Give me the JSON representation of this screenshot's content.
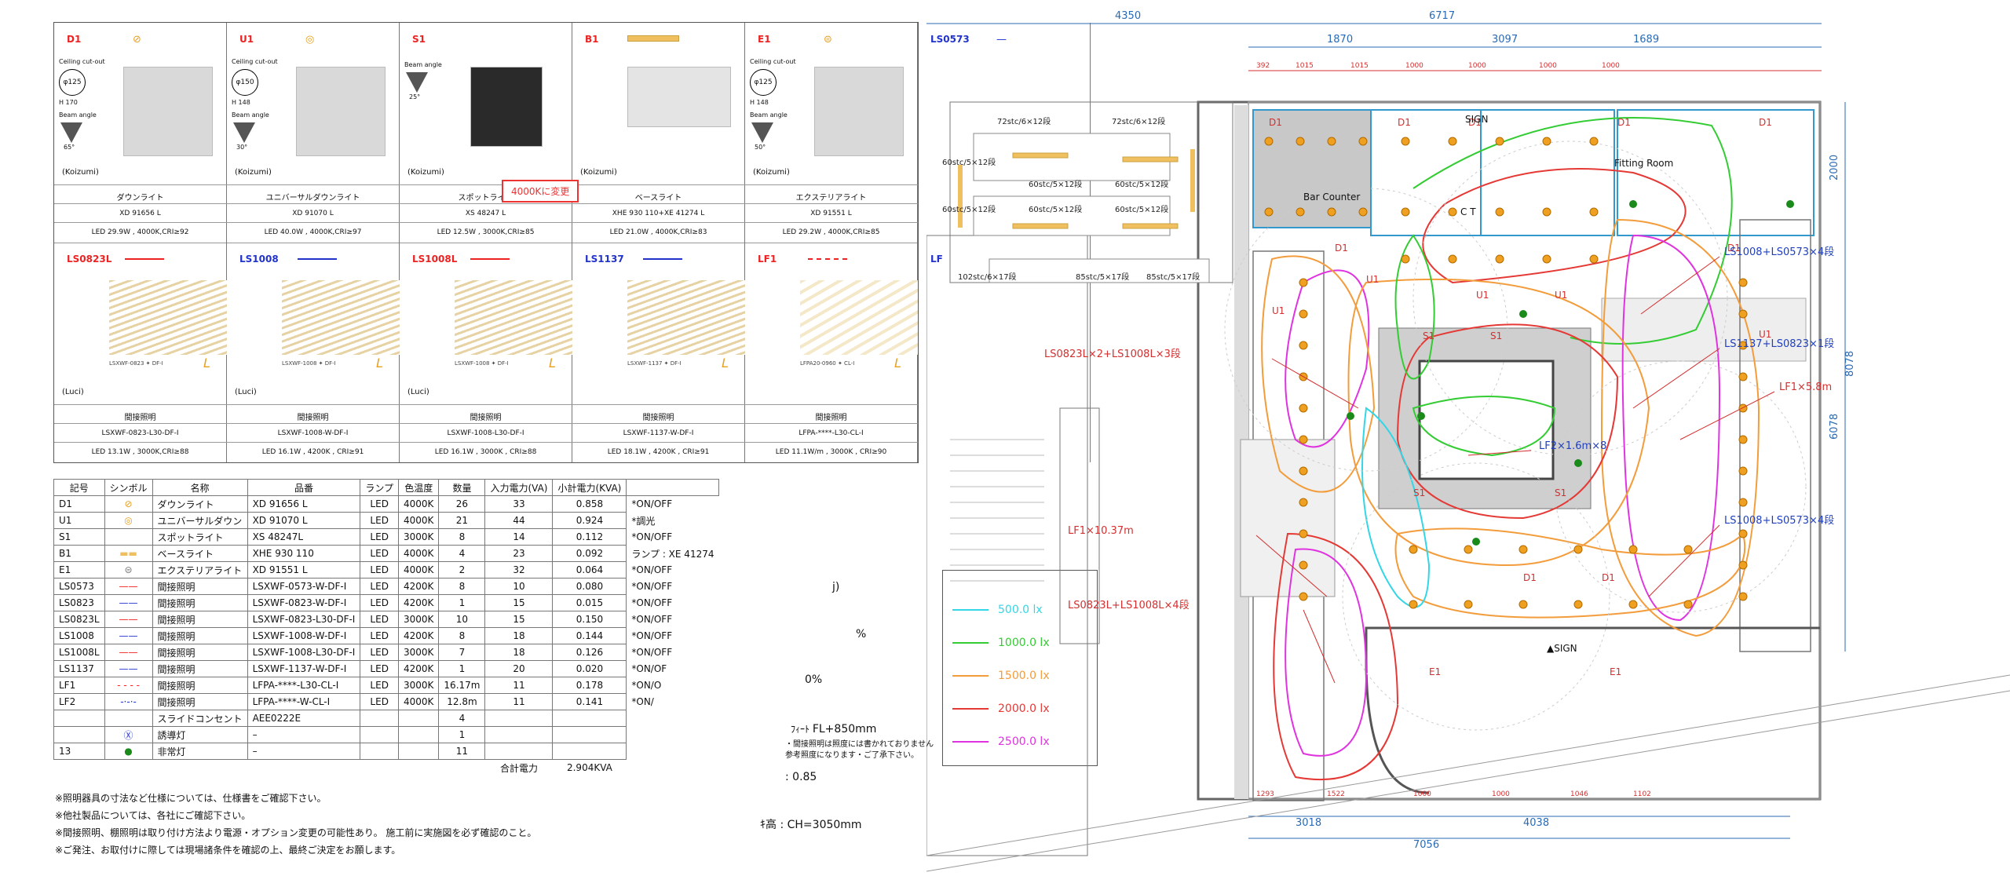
{
  "catalog": {
    "row1": [
      {
        "code": "D1",
        "symbol": "⊘",
        "cutout": "Ceiling cut-out",
        "cutout_dim": "φ125",
        "h": "H 170",
        "beam_label": "Beam angle",
        "beam": "65°",
        "maker": "(Koizumi)",
        "name": "ダウンライト",
        "model": "XD 91656 L",
        "spec": "LED 29.9W , 4000K,CRI≥92"
      },
      {
        "code": "U1",
        "symbol": "◎",
        "cutout": "Ceiling cut-out",
        "cutout_dim": "φ150",
        "h": "H 148",
        "beam_label": "Beam angle",
        "beam": "30°",
        "maker": "(Koizumi)",
        "name": "ユニバーサルダウンライト",
        "model": "XD 91070 L",
        "spec": "LED 40.0W , 4000K,CRI≥97"
      },
      {
        "code": "S1",
        "symbol": "",
        "cutout": "",
        "cutout_dim": "",
        "h": "",
        "beam_label": "Beam angle",
        "beam": "25°",
        "maker": "(Koizumi)",
        "name": "スポットライト",
        "model": "XS 48247 L",
        "spec": "LED 12.5W , 3000K,CRI≥85"
      },
      {
        "code": "B1",
        "symbol": "▬",
        "cutout": "",
        "cutout_dim": "",
        "h": "",
        "beam_label": "",
        "beam": "",
        "maker": "(Koizumi)",
        "name": "ベースライト",
        "model": "XHE 930 110+XE 41274 L",
        "spec": "LED 21.0W , 4000K,CRI≥83"
      },
      {
        "code": "E1",
        "symbol": "⊜",
        "cutout": "Ceiling cut-out",
        "cutout_dim": "φ125",
        "h": "H 148",
        "beam_label": "Beam angle",
        "beam": "50°",
        "maker": "(Koizumi)",
        "name": "エクステリアライト",
        "model": "XD 91551 L",
        "spec": "LED 29.2W , 4000K,CRI≥85"
      },
      {
        "code": "LS0573",
        "symbol": "—",
        "cutout": "",
        "cutout_dim": "",
        "h": "",
        "beam_label": "",
        "beam": "",
        "maker": "(Luci)",
        "name": "",
        "model": "",
        "spec": ""
      }
    ],
    "row2": [
      {
        "code": "LS0823L",
        "maker": "(Luci)",
        "name": "間接照明",
        "model": "LSXWF-0823-L30-DF-I",
        "spec": "LED 13.1W , 3000K,CRI≥88",
        "label": "LSXWF-0823 ✦ DF-I"
      },
      {
        "code": "LS1008",
        "maker": "(Luci)",
        "name": "間接照明",
        "model": "LSXWF-1008-W-DF-I",
        "spec": "LED 16.1W , 4200K , CRI≥91",
        "label": "LSXWF-1008 ✦ DF-I"
      },
      {
        "code": "LS1008L",
        "maker": "(Luci)",
        "name": "間接照明",
        "model": "LSXWF-1008-L30-DF-I",
        "spec": "LED 16.1W , 3000K , CRI≥88",
        "label": "LSXWF-1008 ✦ DF-I"
      },
      {
        "code": "LS1137",
        "maker": "",
        "name": "間接照明",
        "model": "LSXWF-1137-W-DF-I",
        "spec": "LED 18.1W , 4200K , CRI≥91",
        "label": "LSXWF-1137 ✦ DF-I"
      },
      {
        "code": "LF1",
        "maker": "",
        "name": "間接照明",
        "model": "LFPA-****-L30-CL-I",
        "spec": "LED 11.1W/m , 3000K , CRI≥90",
        "label": "LFPA20-0960 ✦ CL-I"
      },
      {
        "code": "LF",
        "maker": "",
        "name": "",
        "model": "",
        "spec": "",
        "label": ""
      }
    ],
    "change_note": "4000Kに変更"
  },
  "schedule": {
    "headers": [
      "記号",
      "シンボル",
      "名称",
      "品番",
      "ランプ",
      "色温度",
      "数量",
      "入力電力(VA)",
      "小計電力(KVA)",
      ""
    ],
    "rows": [
      [
        "D1",
        "⊘",
        "ダウンライト",
        "XD 91656 L",
        "LED",
        "4000K",
        "26",
        "33",
        "0.858",
        "*ON/OFF"
      ],
      [
        "U1",
        "◎",
        "ユニバーサルダウン",
        "XD 91070 L",
        "LED",
        "4000K",
        "21",
        "44",
        "0.924",
        "*調光"
      ],
      [
        "S1",
        "",
        "スポットライト",
        "XS 48247L",
        "LED",
        "3000K",
        "8",
        "14",
        "0.112",
        "*ON/OFF"
      ],
      [
        "B1",
        "▬▬",
        "ベースライト",
        "XHE 930 110",
        "LED",
        "4000K",
        "4",
        "23",
        "0.092",
        "ランプ : XE 41274"
      ],
      [
        "E1",
        "⊜",
        "エクステリアライト",
        "XD 91551 L",
        "LED",
        "4000K",
        "2",
        "32",
        "0.064",
        "*ON/OFF"
      ],
      [
        "LS0573",
        "——",
        "間接照明",
        "LSXWF-0573-W-DF-I",
        "LED",
        "4200K",
        "8",
        "10",
        "0.080",
        "*ON/OFF"
      ],
      [
        "LS0823",
        "——",
        "間接照明",
        "LSXWF-0823-W-DF-I",
        "LED",
        "4200K",
        "1",
        "15",
        "0.015",
        "*ON/OFF"
      ],
      [
        "LS0823L",
        "——",
        "間接照明",
        "LSXWF-0823-L30-DF-I",
        "LED",
        "3000K",
        "10",
        "15",
        "0.150",
        "*ON/OFF"
      ],
      [
        "LS1008",
        "——",
        "間接照明",
        "LSXWF-1008-W-DF-I",
        "LED",
        "4200K",
        "8",
        "18",
        "0.144",
        "*ON/OFF"
      ],
      [
        "LS1008L",
        "——",
        "間接照明",
        "LSXWF-1008-L30-DF-I",
        "LED",
        "3000K",
        "7",
        "18",
        "0.126",
        "*ON/OFF"
      ],
      [
        "LS1137",
        "——",
        "間接照明",
        "LSXWF-1137-W-DF-I",
        "LED",
        "4200K",
        "1",
        "20",
        "0.020",
        "*ON/OF"
      ],
      [
        "LF1",
        "- - - -",
        "間接照明",
        "LFPA-****-L30-CL-I",
        "LED",
        "3000K",
        "16.17m",
        "11",
        "0.178",
        "*ON/O"
      ],
      [
        "LF2",
        "-·-·-",
        "間接照明",
        "LFPA-****-W-CL-I",
        "LED",
        "4000K",
        "12.8m",
        "11",
        "0.141",
        "*ON/"
      ],
      [
        "",
        "",
        "スライドコンセント",
        "AEE0222E",
        "",
        "",
        "4",
        "",
        "",
        ""
      ],
      [
        "",
        "Ⓧ",
        "誘導灯",
        "–",
        "",
        "",
        "1",
        "",
        "",
        ""
      ],
      [
        "13",
        "●",
        "非常灯",
        "–",
        "",
        "",
        "11",
        "",
        "",
        ""
      ]
    ],
    "total_label": "合計電力",
    "total_value": "2.904KVA"
  },
  "notes": [
    "※照明器具の寸法など仕様については、仕様書をご確認下さい。",
    "※他社製品については、各社にご確認下さい。",
    "※間接照明、棚照明は取り付け方法より電源・オプション変更の可能性あり。 施工前に実施図を必ず確認のこと。",
    "※ご発注、お取付けに際しては現場諸条件を確認の上、最終ご決定をお願します。"
  ],
  "side_texts": {
    "fl": "FL+850mm",
    "indirect_note": "・間接照明は照度には書かれておりません",
    "ref_note": "参考照度になります・ご了承下さい。",
    "ratio": "0.85",
    "ceiling": "CH=3050mm",
    "j": "j)",
    "pct1": "%",
    "pct2": "0%"
  },
  "legend": [
    {
      "label": "500.0 lx",
      "color": "#33d6e6"
    },
    {
      "label": "1000.0 lx",
      "color": "#33cc33"
    },
    {
      "label": "1500.0 lx",
      "color": "#f39c3b"
    },
    {
      "label": "2000.0 lx",
      "color": "#e53935"
    },
    {
      "label": "2500.0 lx",
      "color": "#e033e0"
    }
  ],
  "plan": {
    "dims_top": [
      "4350",
      "6717",
      "1870",
      "3097",
      "1689"
    ],
    "dims_sub": [
      "392",
      "1015",
      "1015",
      "1000",
      "1000",
      "1000",
      "1000"
    ],
    "dims_right": [
      "2000",
      "8078",
      "6078"
    ],
    "dims_bottom": [
      "3018",
      "4038",
      "7056"
    ],
    "dims_bottom_sub": [
      "1293",
      "1522",
      "1000",
      "1000",
      "1046",
      "1102"
    ],
    "rooms": [
      "Bar Counter",
      "Fitting Room",
      "SIGN",
      "▲SIGN",
      "C T"
    ],
    "callouts": [
      {
        "text": "LS1008+LS0573×4段"
      },
      {
        "text": "LS1137+LS0823×1段"
      },
      {
        "text": "LF1×5.8m"
      },
      {
        "text": "LS0823L×2+LS1008L×3段"
      },
      {
        "text": "LF2×1.6m×8"
      },
      {
        "text": "LF1×10.37m"
      },
      {
        "text": "LS0823L+LS1008L×4段"
      },
      {
        "text": "LS1008+LS0573×4段"
      }
    ],
    "shelves": [
      "72stc/6×12段",
      "72stc/6×12段",
      "60stc/5×12段",
      "60stc/5×12段",
      "60stc/5×12段",
      "60stc/5×12段",
      "102stc/6×17段",
      "85stc/5×17段",
      "85stc/5×17段",
      "60stc/5×12段",
      "60stc/5×12段"
    ],
    "fixture_labels": [
      "D1",
      "U1",
      "S1",
      "B1",
      "E1"
    ]
  }
}
